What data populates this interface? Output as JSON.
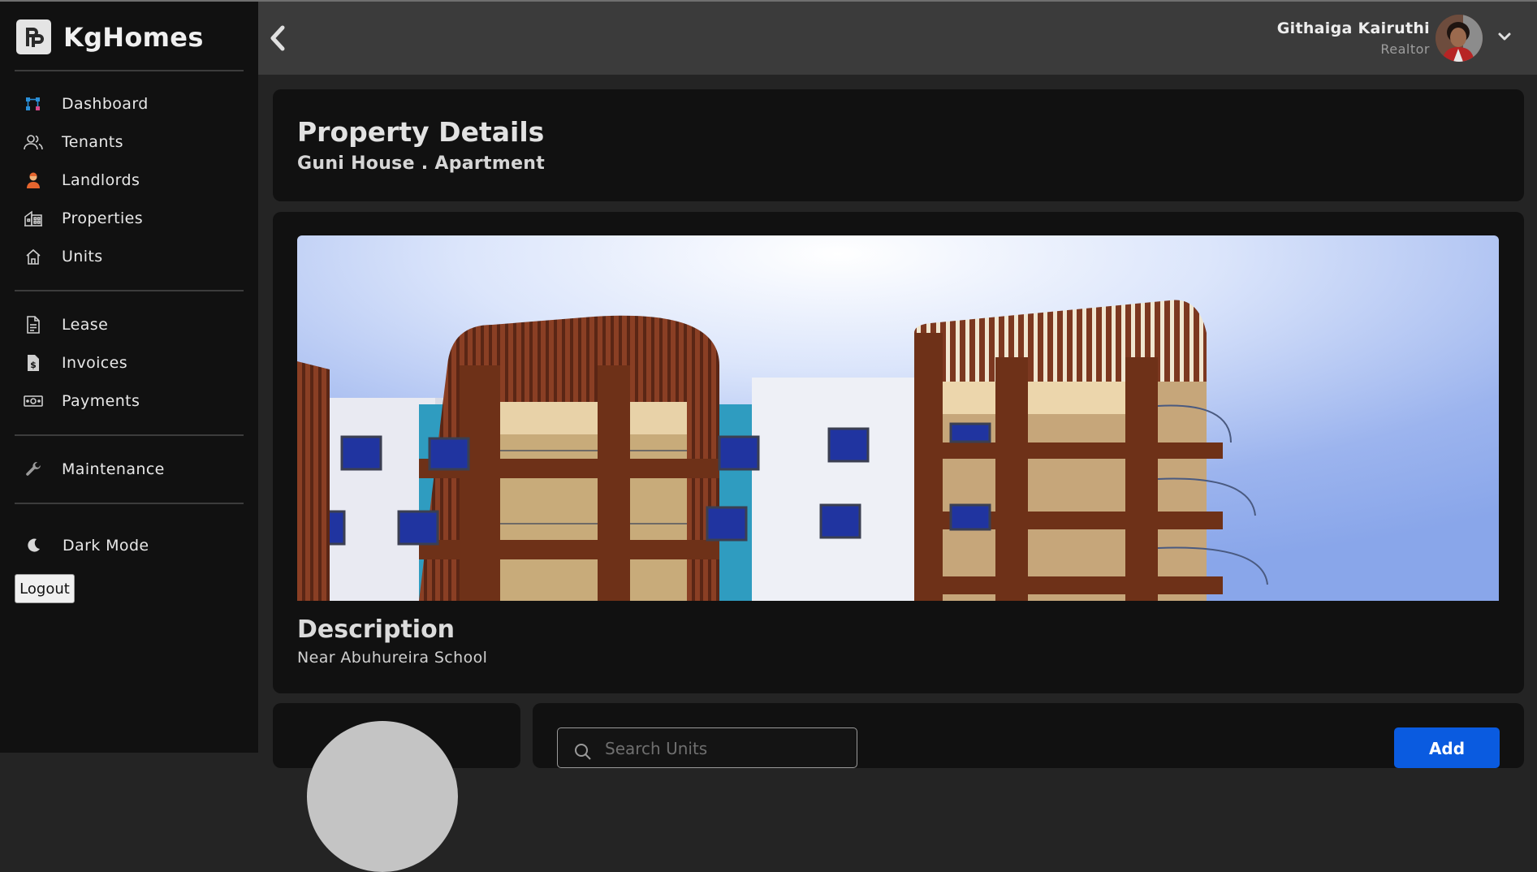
{
  "app": {
    "brand_name": "KgHomes"
  },
  "sidebar": {
    "items": [
      {
        "label": "Dashboard",
        "icon": "dashboard-icon"
      },
      {
        "label": "Tenants",
        "icon": "users-icon"
      },
      {
        "label": "Landlords",
        "icon": "landlord-icon"
      },
      {
        "label": "Properties",
        "icon": "building-icon"
      },
      {
        "label": "Units",
        "icon": "home-icon"
      },
      {
        "label": "Lease",
        "icon": "document-icon"
      },
      {
        "label": "Invoices",
        "icon": "invoice-icon"
      },
      {
        "label": "Payments",
        "icon": "money-icon"
      },
      {
        "label": "Maintenance",
        "icon": "wrench-icon"
      }
    ],
    "dark_mode_label": "Dark Mode",
    "logout_label": "Logout"
  },
  "header": {
    "user_name": "Githaiga Kairuthi",
    "user_role": "Realtor"
  },
  "property": {
    "title": "Property Details",
    "subtitle": "Guni House . Apartment",
    "description_title": "Description",
    "description_text": "Near Abuhureira School"
  },
  "units": {
    "search_placeholder": "Search Units",
    "add_label": "Add"
  },
  "colors": {
    "sidebar_bg": "#111111",
    "main_bg": "#242424",
    "topbar_bg": "#3b3b3b",
    "accent": "#0a5be0"
  }
}
